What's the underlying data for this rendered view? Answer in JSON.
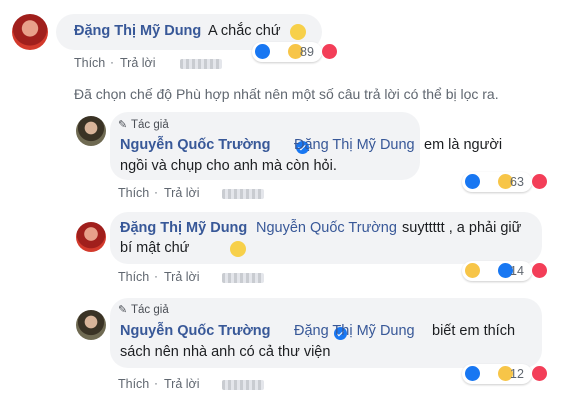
{
  "comments": [
    {
      "author": "Đặng Thị Mỹ Dung",
      "text": "A chắc chứ",
      "emoji": "smile-icon",
      "reaction_count": "89",
      "reactions": [
        "like-icon",
        "haha-icon",
        "love-icon"
      ],
      "like_label": "Thích",
      "reply_label": "Trả lời"
    },
    {
      "author_tag": "Tác giả",
      "author": "Nguyễn Quốc Trường",
      "mention": "Đặng Thị Mỹ Dung",
      "text_line1": "em là người",
      "text_line2": "ngồi và chụp cho anh mà còn hỏi.",
      "reaction_count": "63",
      "reactions": [
        "like-icon",
        "haha-icon",
        "love-icon"
      ],
      "like_label": "Thích",
      "reply_label": "Trả lời"
    },
    {
      "author": "Đặng Thị Mỹ Dung",
      "mention": "Nguyễn Quốc Trường",
      "text_line1": "suyttttt , a phải giữ",
      "text_line2": "bí mật chứ",
      "emoji": "shush-icon",
      "reaction_count": "14",
      "reactions": [
        "haha-icon",
        "like-icon",
        "love-icon"
      ],
      "like_label": "Thích",
      "reply_label": "Trả lời"
    },
    {
      "author_tag": "Tác giả",
      "author": "Nguyễn Quốc Trường",
      "mention": "Đặng Thị Mỹ Dung",
      "text_line1": "biết em thích",
      "text_line2": "sách nên nhà anh có cả thư viện",
      "reaction_count": "12",
      "reactions": [
        "like-icon",
        "haha-icon",
        "love-icon"
      ],
      "like_label": "Thích",
      "reply_label": "Trả lời"
    }
  ],
  "filter_notice": "Đã chọn chế độ Phù hợp nhất nên một số câu trả lời có thể bị lọc ra.",
  "colors": {
    "link": "#385898",
    "bubble": "#f2f3f5",
    "like": "#1877f2",
    "love": "#f33e58",
    "haha": "#f7c548"
  }
}
